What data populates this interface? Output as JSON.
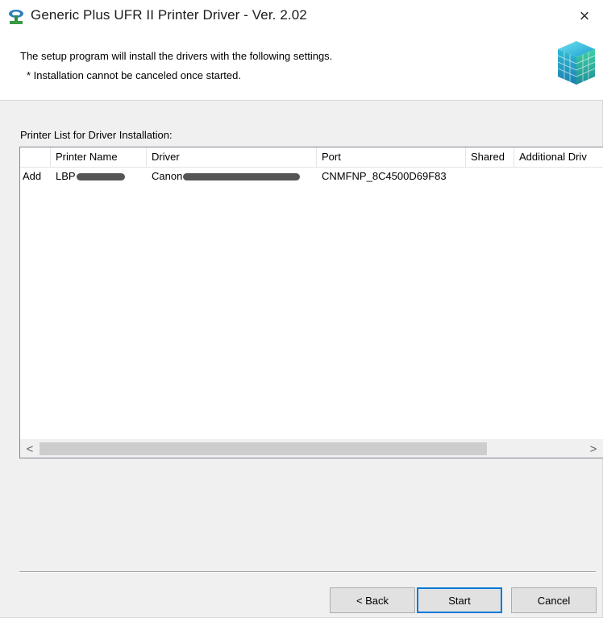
{
  "window": {
    "title": "Generic Plus UFR II Printer Driver - Ver. 2.02",
    "close_label": "×"
  },
  "header": {
    "line1": "The setup program will install the drivers with the following settings.",
    "line2": "* Installation cannot be canceled once started."
  },
  "printer_list": {
    "label": "Printer List for Driver Installation:",
    "columns": [
      "",
      "Printer Name",
      "Driver",
      "Port",
      "Shared",
      "Additional Driv"
    ],
    "rows": [
      {
        "action": "Add",
        "printer_name": "LBP",
        "driver": "Canon",
        "port": "CNMFNP_8C4500D69F83",
        "shared": "",
        "additional": ""
      }
    ],
    "scroll_left": "<",
    "scroll_right": ">"
  },
  "buttons": {
    "back": "< Back",
    "start": "Start",
    "cancel": "Cancel"
  },
  "colors": {
    "accent": "#0078d7",
    "window_bg": "#f0f0f0"
  },
  "icons": [
    "printer-setup-icon",
    "cube-logo-icon",
    "close-icon"
  ]
}
